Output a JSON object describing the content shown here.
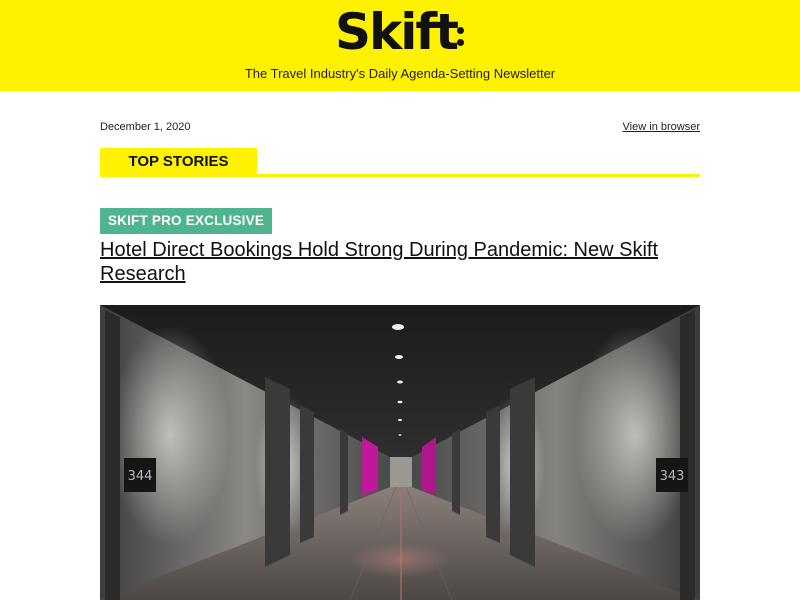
{
  "header": {
    "logo_text": "Skift",
    "tagline": "The Travel Industry's Daily Agenda-Setting Newsletter",
    "background_color": "#fff200"
  },
  "meta": {
    "date": "December 1, 2020",
    "view_in_browser": "View in browser"
  },
  "section": {
    "title": "TOP STORIES"
  },
  "story": {
    "badge": "SKIFT PRO EXCLUSIVE",
    "badge_color": "#4fb58e",
    "headline": "Hotel Direct Bookings Hold Strong During Pandemic: New Skift Research",
    "image": {
      "room_left": "344",
      "room_right": "343"
    }
  }
}
